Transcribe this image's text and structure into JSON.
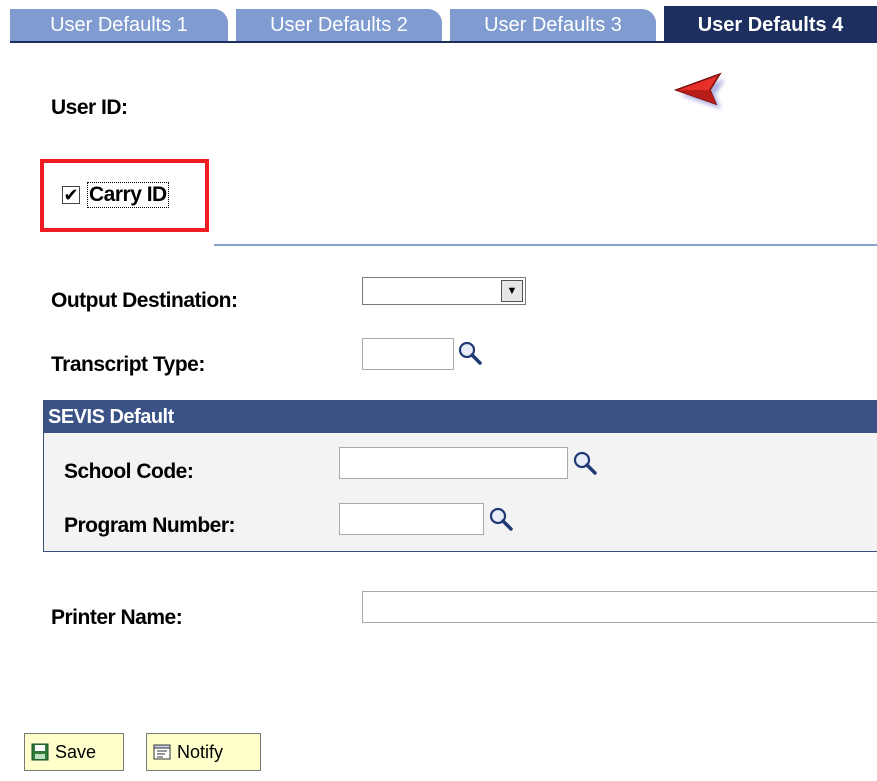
{
  "tabs": [
    {
      "label": "User Defaults 1"
    },
    {
      "label": "User Defaults 2"
    },
    {
      "label": "User Defaults 3"
    },
    {
      "label": "User Defaults 4",
      "active": true
    }
  ],
  "fields": {
    "user_id_label": "User ID:",
    "carry_id_label": "Carry ID",
    "carry_id_checked": true,
    "output_destination_label": "Output Destination:",
    "output_destination_value": "",
    "transcript_type_label": "Transcript Type:",
    "transcript_type_value": "",
    "printer_name_label": "Printer Name:",
    "printer_name_value": ""
  },
  "sevis": {
    "title": "SEVIS Default",
    "school_code_label": "School Code:",
    "school_code_value": "",
    "program_number_label": "Program Number:",
    "program_number_value": ""
  },
  "buttons": {
    "save_label": "Save",
    "notify_label": "Notify"
  },
  "colors": {
    "tab_inactive": "#7f9bcf",
    "tab_active": "#1d2f5f",
    "highlight": "#ef1c24",
    "group_header": "#3a5285",
    "button_bg": "#ffffcc"
  },
  "icons": {
    "cursor": "cursor-arrow-icon",
    "lookup": "magnifier-icon",
    "save": "floppy-disk-icon",
    "notify": "notepad-icon"
  }
}
